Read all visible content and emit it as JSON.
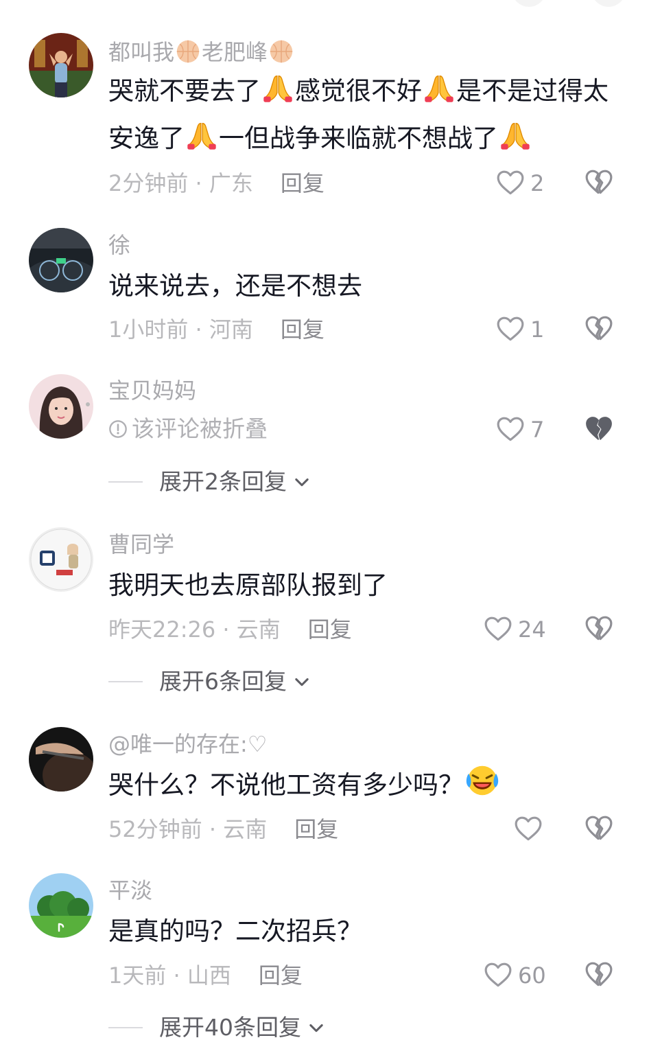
{
  "comments": [
    {
      "username": "都叫我",
      "username_2": "老肥峰",
      "name_emoji": "basketball-icon",
      "text_1": "哭就不要去了",
      "text_2": "感觉很不好",
      "text_3": "是不是过得太安逸了",
      "text_4": "一但战争来临就不想战了",
      "text_emoji": "praying-hands-icon",
      "time_location": "2分钟前 · 广东",
      "reply": "回复",
      "likes": "2"
    },
    {
      "username": "徐",
      "text": "说来说去，还是不想去",
      "time_location": "1小时前 · 河南",
      "reply": "回复",
      "likes": "1"
    },
    {
      "username": "宝贝妈妈",
      "folded_text": "该评论被折叠",
      "likes": "7",
      "expand": "展开2条回复"
    },
    {
      "username": "曹同学",
      "text": "我明天也去原部队报到了",
      "time_location": "昨天22:26 · 云南",
      "reply": "回复",
      "likes": "24",
      "expand": "展开6条回复"
    },
    {
      "username": "@唯一的存在:♡",
      "text": "哭什么？不说他工资有多少吗？",
      "text_emoji": "laughing-crying-icon",
      "time_location": "52分钟前 · 云南",
      "reply": "回复",
      "likes": ""
    },
    {
      "username": "平淡",
      "text": "是真的吗？二次招兵？",
      "time_location": "1天前 · 山西",
      "reply": "回复",
      "likes": "60",
      "expand": "展开40条回复"
    }
  ],
  "colors": {
    "text_primary": "#161823",
    "text_secondary": "#a9a9ad",
    "background": "#ffffff"
  }
}
